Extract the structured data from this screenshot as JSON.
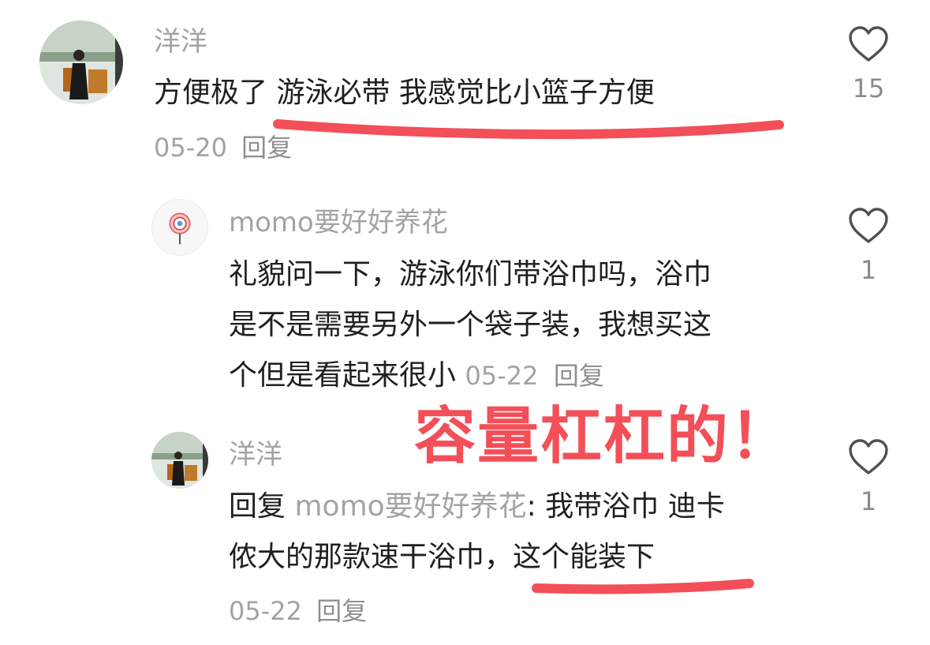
{
  "comments": [
    {
      "username": "洋洋",
      "text": "方便极了 游泳必带 我感觉比小篮子方便",
      "date": "05-20",
      "reply_label": "回复",
      "like_count": "15",
      "avatar_icon": "photo-avatar-icon"
    },
    {
      "username": "momo要好好养花",
      "text_lines": [
        "礼貌问一下，游泳你们带浴巾吗，浴巾",
        "是不是需要另外一个袋子装，我想买这",
        "个但是看起来很小"
      ],
      "date": "05-22",
      "reply_label": "回复",
      "like_count": "1",
      "avatar_icon": "lollipop-avatar-icon"
    },
    {
      "username": "洋洋",
      "reply_prefix": "回复",
      "reply_to": "momo要好好养花",
      "colon": ":",
      "text_lines": [
        " 我带浴巾 迪卡",
        "侬大的那款速干浴巾，这个能装下"
      ],
      "date": "05-22",
      "reply_label": "回复",
      "like_count": "1",
      "avatar_icon": "photo-avatar-icon"
    }
  ],
  "annotation": {
    "text": "容量杠杠的！",
    "color": "#f24f58"
  },
  "colors": {
    "username": "#a3a3a3",
    "body": "#1f1f1f",
    "highlight": "#f24f58"
  }
}
